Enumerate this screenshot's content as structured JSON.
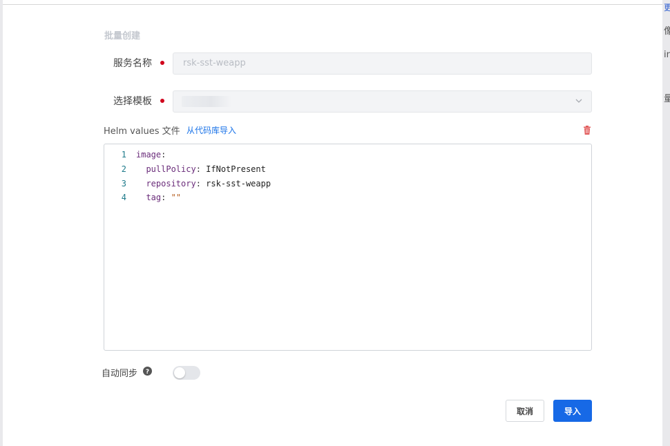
{
  "background_fragments": [
    "更",
    "像",
    "in",
    "量"
  ],
  "dialog": {
    "section_title": "批量创建",
    "service_name": {
      "label": "服务名称",
      "value": "rsk-sst-weapp"
    },
    "template": {
      "label": "选择模板",
      "icon": "chevron-down-icon"
    },
    "helm": {
      "label": "Helm values 文件",
      "import_link": "从代码库导入",
      "delete_icon": "trash-icon"
    },
    "editor": {
      "lines": [
        {
          "num": "1",
          "key": "image",
          "colon": ":",
          "value": ""
        },
        {
          "num": "2",
          "indent": "  ",
          "key": "pullPolicy",
          "colon": ":",
          "value": " IfNotPresent"
        },
        {
          "num": "3",
          "indent": "  ",
          "key": "repository",
          "colon": ":",
          "value": " rsk-sst-weapp"
        },
        {
          "num": "4",
          "indent": "  ",
          "key": "tag",
          "colon": ":",
          "value": " \"\""
        }
      ]
    },
    "auto_sync": {
      "label": "自动同步",
      "enabled": false
    },
    "buttons": {
      "cancel": "取消",
      "import": "导入"
    },
    "colors": {
      "primary": "#1769e6",
      "required": "#d0021b",
      "link": "#1a73e8",
      "danger": "#e25c5c"
    }
  }
}
